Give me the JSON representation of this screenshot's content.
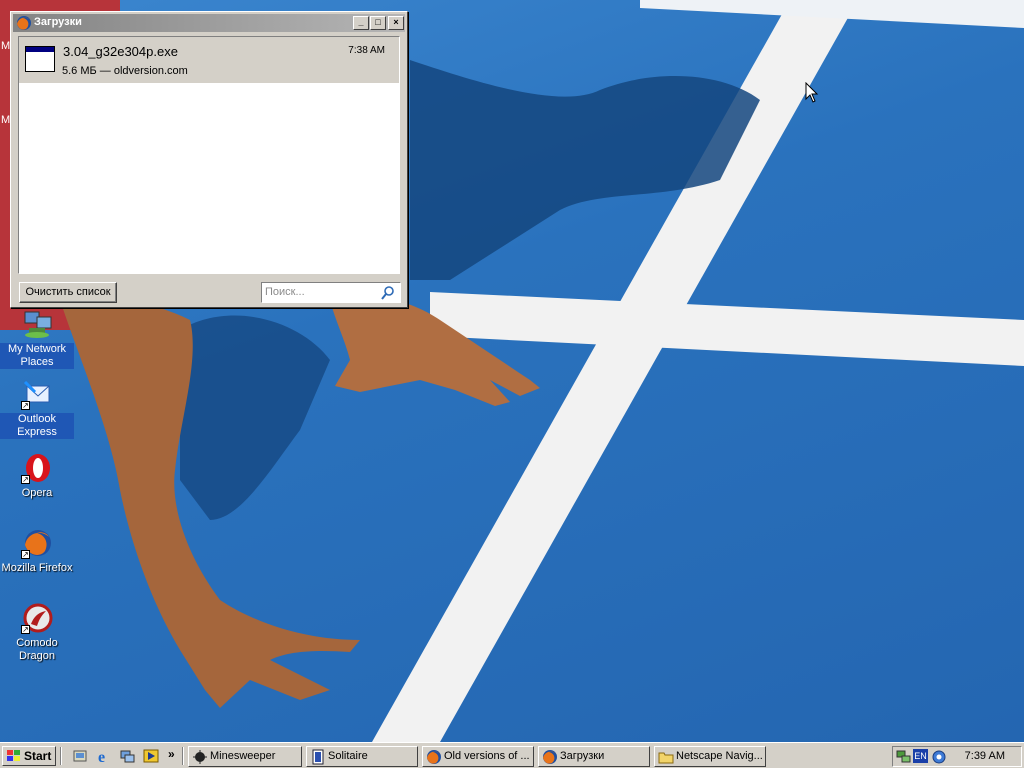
{
  "desktop": {
    "icons": [
      {
        "label": "My Network Places",
        "icon": "network-places-icon"
      },
      {
        "label": "Outlook Express",
        "icon": "outlook-express-icon"
      },
      {
        "label": "Opera",
        "icon": "opera-icon"
      },
      {
        "label": "Mozilla Firefox",
        "icon": "firefox-icon"
      },
      {
        "label": "Comodo Dragon",
        "icon": "comodo-dragon-icon"
      }
    ],
    "partial_left_labels": [
      "M",
      "M"
    ]
  },
  "download_window": {
    "title": "Загрузки",
    "buttons": {
      "minimize": "_",
      "maximize": "□",
      "close": "×"
    },
    "items": [
      {
        "filename": "3.04_g32e304p.exe",
        "meta": "5.6 МБ — oldversion.com",
        "time": "7:38 AM"
      }
    ],
    "clear_button": "Очистить список",
    "search_placeholder": "Поиск..."
  },
  "taskbar": {
    "start_label": "Start",
    "quick_launch": [
      "show-desktop-icon",
      "internet-explorer-icon",
      "network-icon",
      "media-icon"
    ],
    "chevron": "»",
    "tasks": [
      {
        "label": "Minesweeper",
        "icon": "minesweeper-icon"
      },
      {
        "label": "Solitaire",
        "icon": "solitaire-icon"
      },
      {
        "label": "Old versions of ...",
        "icon": "firefox-icon"
      },
      {
        "label": "Загрузки",
        "icon": "firefox-icon"
      },
      {
        "label": "Netscape Navig...",
        "icon": "folder-icon"
      }
    ],
    "tray": {
      "language": "EN",
      "clock": "7:39 AM"
    }
  },
  "colors": {
    "track_blue": "#2a72bd",
    "lane_white": "#f4f4f4",
    "window_gray": "#d4d0c8",
    "selection_blue": "#1f57b5"
  }
}
